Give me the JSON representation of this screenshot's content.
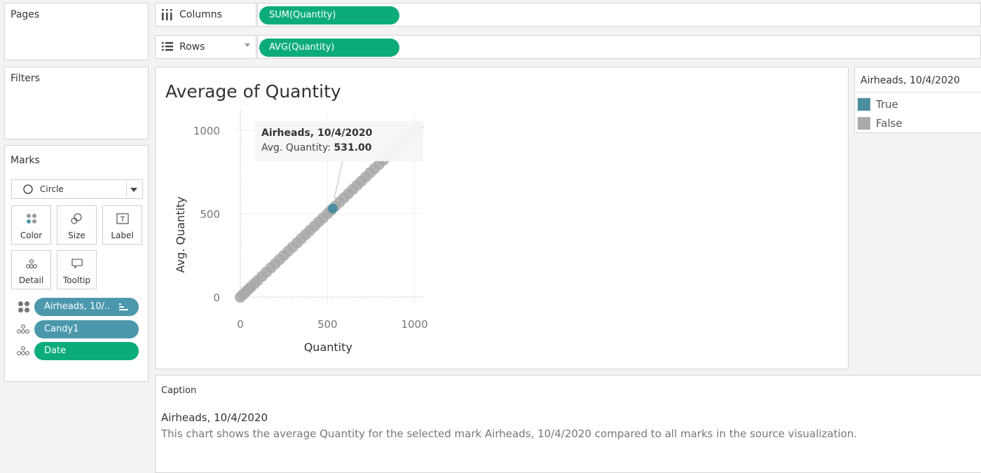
{
  "panes": {
    "pages": "Pages",
    "filters": "Filters",
    "marks": "Marks"
  },
  "shelves": {
    "columns": {
      "label": "Columns",
      "pill": "SUM(Quantity)"
    },
    "rows": {
      "label": "Rows",
      "pill": "AVG(Quantity)"
    }
  },
  "marks": {
    "type": "Circle",
    "buttons": {
      "color": "Color",
      "size": "Size",
      "label": "Label",
      "detail": "Detail",
      "tooltip": "Tooltip"
    },
    "fields": [
      {
        "name": "Airheads, 10/..",
        "role": "color"
      },
      {
        "name": "Candy1",
        "role": "detail"
      },
      {
        "name": "Date",
        "role": "detail"
      }
    ]
  },
  "legend": {
    "title": "Airheads, 10/4/2020",
    "items": [
      {
        "label": "True",
        "color": "#4b8ea1"
      },
      {
        "label": "False",
        "color": "#a9a9a9"
      }
    ]
  },
  "tooltip": {
    "title": "Airheads, 10/4/2020",
    "measure_label": "Avg. Quantity:",
    "measure_value": "531.00"
  },
  "caption": {
    "header": "Caption",
    "title": "Airheads, 10/4/2020",
    "text": "This chart shows the average Quantity for the selected mark Airheads, 10/4/2020 compared to all marks in the source visualization."
  },
  "colors": {
    "green_pill": "#0bac7a",
    "blue_pill": "#4b98ad",
    "highlight": "#4b8ea1",
    "other": "#a9a9a9"
  },
  "chart_data": {
    "type": "scatter",
    "title": "Average of Quantity",
    "xlabel": "Quantity",
    "ylabel": "Avg. Quantity",
    "xlim": [
      0,
      1050
    ],
    "ylim": [
      0,
      1050
    ],
    "xticks": [
      0,
      500,
      1000
    ],
    "yticks": [
      0,
      500,
      1000
    ],
    "reference_lines": {
      "x": 0,
      "y": 0
    },
    "series": [
      {
        "name": "False",
        "color": "#a9a9a9",
        "x": [
          0,
          15,
          30,
          45,
          60,
          80,
          100,
          125,
          150,
          175,
          200,
          225,
          250,
          275,
          300,
          325,
          350,
          375,
          400,
          425,
          450,
          475,
          500,
          520,
          545,
          570,
          595,
          620,
          645,
          670,
          695,
          720,
          745,
          770,
          795,
          820,
          845,
          870,
          895,
          920,
          945,
          970,
          995,
          1020
        ],
        "y": [
          0,
          15,
          30,
          45,
          60,
          80,
          100,
          125,
          150,
          175,
          200,
          225,
          250,
          275,
          300,
          325,
          350,
          375,
          400,
          425,
          450,
          475,
          500,
          520,
          545,
          570,
          595,
          620,
          645,
          670,
          695,
          720,
          745,
          770,
          795,
          820,
          845,
          870,
          895,
          920,
          945,
          970,
          995,
          1020
        ]
      },
      {
        "name": "True",
        "color": "#4b8ea1",
        "x": [
          531
        ],
        "y": [
          531
        ]
      }
    ]
  }
}
